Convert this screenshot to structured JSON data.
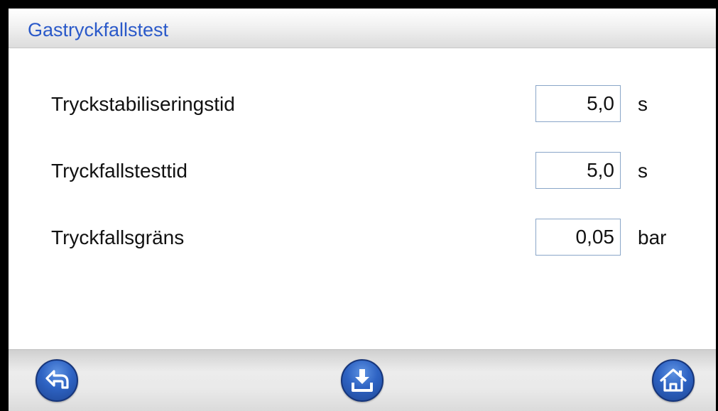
{
  "header": {
    "title": "Gastryckfallstest"
  },
  "settings": [
    {
      "label": "Tryckstabiliseringstid",
      "value": "5,0",
      "unit": "s"
    },
    {
      "label": "Tryckfallstesttid",
      "value": "5,0",
      "unit": "s"
    },
    {
      "label": "Tryckfallsgräns",
      "value": "0,05",
      "unit": "bar"
    }
  ],
  "footer": {
    "buttons": [
      {
        "icon": "back-arrow-icon"
      },
      {
        "icon": "download-save-icon"
      },
      {
        "icon": "home-icon"
      }
    ]
  },
  "colors": {
    "title_text": "#2a59c9",
    "button_blue": "#2e63c3",
    "field_border": "#8aa6c8"
  }
}
